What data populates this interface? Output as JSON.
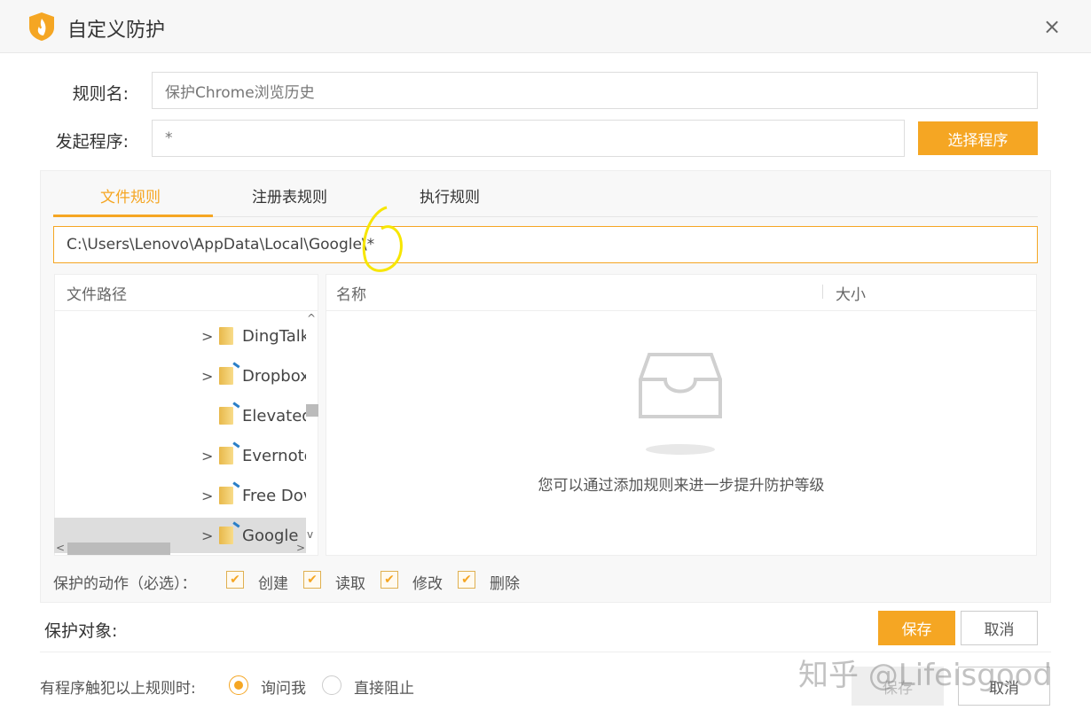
{
  "window": {
    "title": "自定义防护",
    "close": "×"
  },
  "form": {
    "rule_name_label": "规则名:",
    "rule_name_value": "保护Chrome浏览历史",
    "initiator_label": "发起程序:",
    "initiator_value": "*",
    "select_program": "选择程序"
  },
  "tabs": [
    {
      "label": "文件规则",
      "active": true
    },
    {
      "label": "注册表规则"
    },
    {
      "label": "执行规则"
    }
  ],
  "path_value": "C:\\Users\\Lenovo\\AppData\\Local\\Google\\*",
  "tree": {
    "header": "文件路径",
    "items": [
      {
        "name": "DingTalk",
        "expand": true,
        "link": false
      },
      {
        "name": "Dropbox",
        "expand": true,
        "link": true
      },
      {
        "name": "Elevated",
        "expand": false,
        "link": true
      },
      {
        "name": "Evernote",
        "expand": true,
        "link": true
      },
      {
        "name": "Free Dov",
        "expand": true,
        "link": true
      },
      {
        "name": "Google",
        "expand": true,
        "link": true,
        "selected": true
      }
    ]
  },
  "list": {
    "col_name": "名称",
    "col_size": "大小",
    "empty_text": "您可以通过添加规则来进一步提升防护等级"
  },
  "actions": {
    "label": "保护的动作（必选）：",
    "items": [
      "创建",
      "读取",
      "修改",
      "删除"
    ]
  },
  "target": {
    "label": "保护对象:",
    "save": "保存",
    "cancel": "取消"
  },
  "violation": {
    "label": "有程序触犯以上规则时:",
    "options": [
      "询问我",
      "直接阻止"
    ],
    "selected": 0,
    "save": "保存",
    "cancel": "取消"
  },
  "watermark": "知乎 @Lifeisgood",
  "colors": {
    "accent": "#f5a623"
  }
}
